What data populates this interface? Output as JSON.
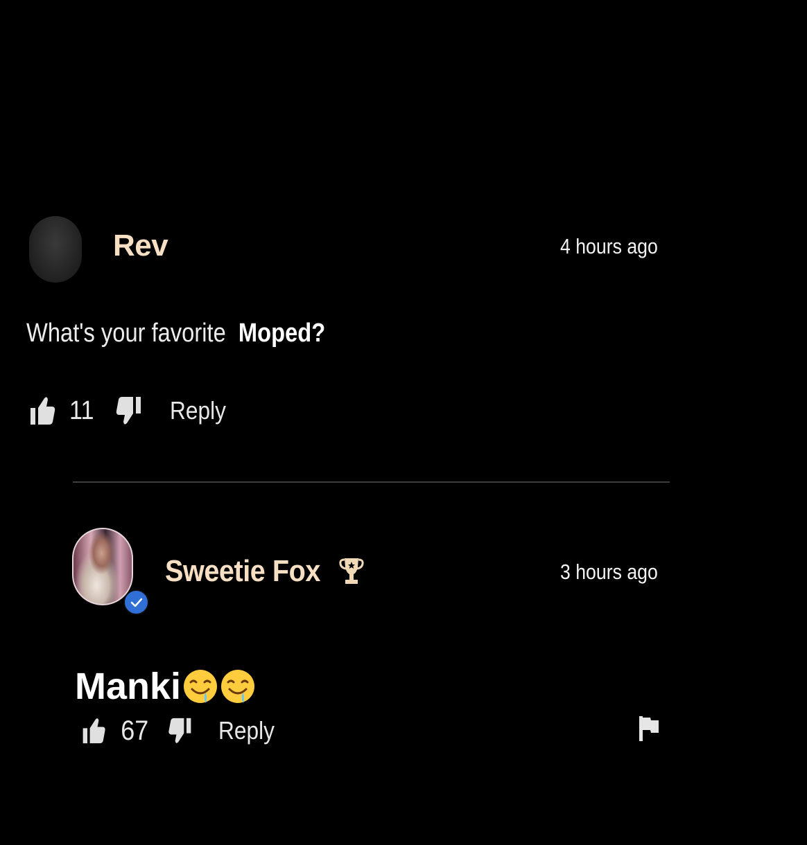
{
  "comments": [
    {
      "username": "Rev",
      "timestamp": "4 hours ago",
      "text_prefix": "What's your favorite",
      "text_bold": "Moped?",
      "likes": "11",
      "reply_label": "Reply",
      "avatar_icon": "default-avatar-icon"
    },
    {
      "username": "Sweetie Fox",
      "timestamp": "3 hours ago",
      "text": "Manki",
      "emojis": [
        "drooling-face-emoji",
        "drooling-face-emoji"
      ],
      "likes": "67",
      "reply_label": "Reply",
      "badges": [
        "trophy-icon",
        "verified-badge-icon"
      ],
      "flag_icon": "flag-icon"
    }
  ],
  "colors": {
    "background": "#000000",
    "username": "#f6dfc2",
    "verified": "#2f6fd6",
    "trophy": "#f0d9b5"
  }
}
